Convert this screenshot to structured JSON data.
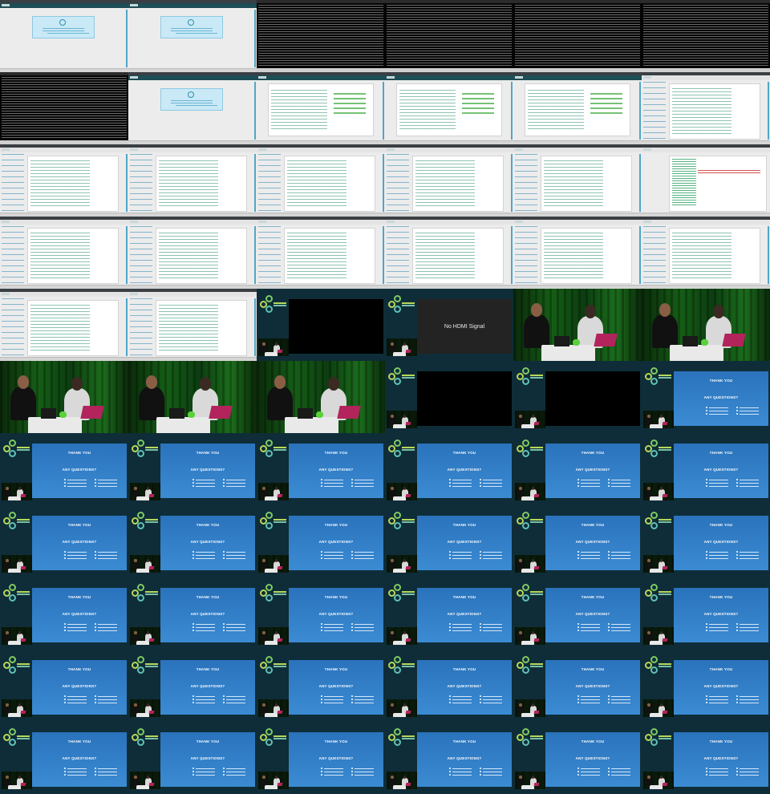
{
  "sheet": {
    "columns": 6,
    "rows": 11,
    "tiles": [
      "screen-loading",
      "screen-loading",
      "terminal",
      "terminal",
      "terminal",
      "terminal",
      "terminal",
      "screen-loading",
      "screen-issue",
      "screen-issue",
      "screen-issue",
      "screen-list",
      "screen-list",
      "screen-list",
      "screen-list",
      "screen-list",
      "screen-list",
      "screen-code",
      "screen-list",
      "screen-list",
      "screen-list",
      "screen-list",
      "screen-list",
      "screen-list",
      "screen-list",
      "screen-list",
      "stream-blank",
      "stream-nohdmi",
      "camera",
      "camera",
      "camera",
      "camera",
      "camera",
      "stream-blank",
      "stream-blank",
      "stream-thanks",
      "stream-thanks",
      "stream-thanks",
      "stream-thanks",
      "stream-thanks",
      "stream-thanks",
      "stream-thanks",
      "stream-thanks",
      "stream-thanks",
      "stream-thanks",
      "stream-thanks",
      "stream-thanks",
      "stream-thanks",
      "stream-thanks",
      "stream-thanks",
      "stream-thanks",
      "stream-thanks",
      "stream-thanks",
      "stream-thanks",
      "stream-thanks",
      "stream-thanks",
      "stream-thanks",
      "stream-thanks",
      "stream-thanks",
      "stream-thanks",
      "stream-thanks",
      "stream-thanks",
      "stream-thanks",
      "stream-thanks",
      "stream-thanks",
      "stream-thanks"
    ]
  },
  "slide": {
    "thank_you": "THANK YOU",
    "any_questions": "ANY QUESTIONS?",
    "no_signal": "No HDMI Signal"
  },
  "colors": {
    "stream_bg": "#0f2d38",
    "slide_blue": "#3b8bd3",
    "accent_green": "#b6d85a"
  }
}
